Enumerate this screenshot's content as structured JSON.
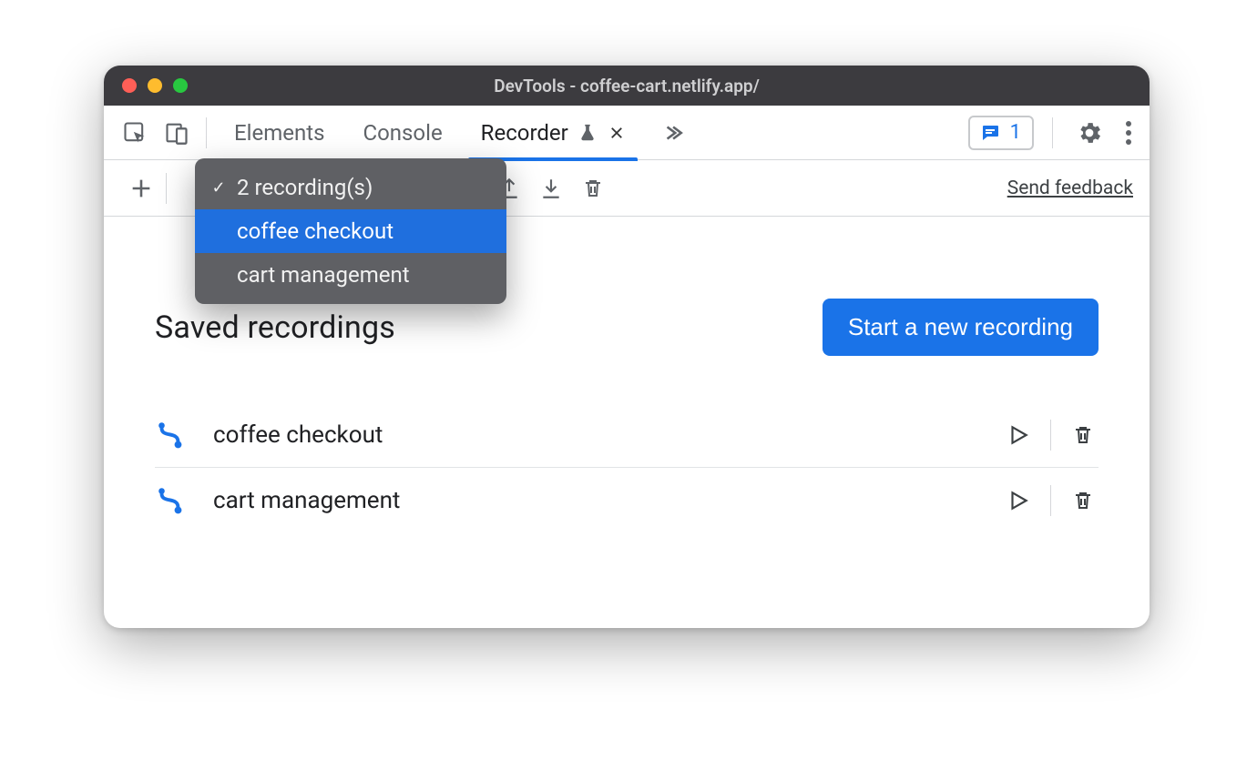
{
  "window": {
    "title": "DevTools - coffee-cart.netlify.app/"
  },
  "tabs": {
    "items": [
      "Elements",
      "Console",
      "Recorder"
    ],
    "active_index": 2
  },
  "issues": {
    "count": "1"
  },
  "toolbar": {
    "feedback": "Send feedback"
  },
  "dropdown": {
    "summary": "2 recording(s)",
    "options": [
      "coffee checkout",
      "cart management"
    ],
    "selected_index": 0
  },
  "page": {
    "heading": "Saved recordings",
    "primary_button": "Start a new recording"
  },
  "recordings": [
    {
      "name": "coffee checkout"
    },
    {
      "name": "cart management"
    }
  ]
}
